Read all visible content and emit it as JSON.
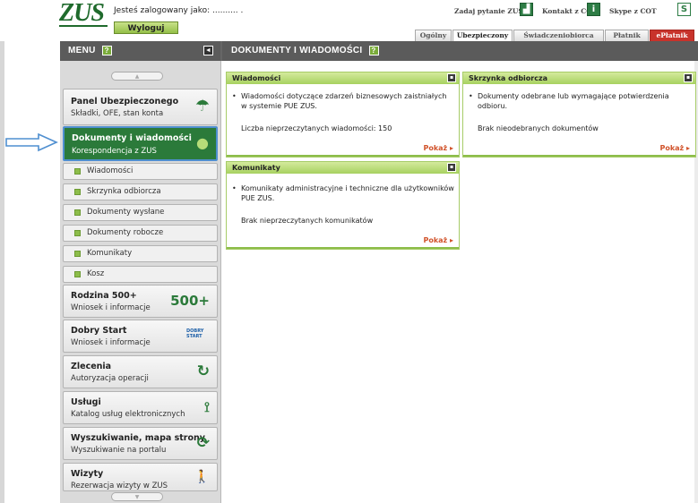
{
  "header": {
    "logo": "ZUS",
    "logged_text": "Jesteś zalogowany jako: .......... .",
    "logout_label": "Wyloguj",
    "ask_link": "Zadaj pytanie ZUS",
    "contact_link": "Kontakt z COT",
    "skype_link": "Skype z COT"
  },
  "tabs": [
    {
      "label": "Ogólny"
    },
    {
      "label": "Ubezpieczony"
    },
    {
      "label": "Świadczeniobiorca"
    },
    {
      "label": "Płatnik"
    },
    {
      "label": "ePłatnik"
    }
  ],
  "menu": {
    "title": "MENU",
    "help": "?",
    "collapse": "◄",
    "scroll_up": "▲",
    "scroll_down": "▼",
    "items": [
      {
        "title": "Panel Ubezpieczonego",
        "subtitle": "Składki, OFE, stan konta",
        "icon": "umbrella-icon",
        "glyph": "☂"
      },
      {
        "title": "Dokumenty i wiadomości",
        "subtitle": "Korespondencja z ZUS",
        "icon": "speech-bubble-icon",
        "glyph": "●"
      },
      {
        "title": "Rodzina 500+",
        "subtitle": "Wniosek i informacje",
        "icon": "rodzina-500-logo",
        "glyph": "500+"
      },
      {
        "title": "Dobry Start",
        "subtitle": "Wniosek i informacje",
        "icon": "dobry-start-logo",
        "glyph": "DOBRY START"
      },
      {
        "title": "Zlecenia",
        "subtitle": "Autoryzacja operacji",
        "icon": "refresh-icon",
        "glyph": "↻"
      },
      {
        "title": "Usługi",
        "subtitle": "Katalog usług elektronicznych",
        "icon": "usb-icon",
        "glyph": "⟟"
      },
      {
        "title": "Wyszukiwanie, mapa strony",
        "subtitle": "Wyszukiwanie na portalu",
        "icon": "sync-icon",
        "glyph": "⟳"
      },
      {
        "title": "Wizyty",
        "subtitle": "Rezerwacja wizyty w ZUS",
        "icon": "walking-person-icon",
        "glyph": "🚶"
      }
    ],
    "subitems": [
      {
        "label": "Wiadomości"
      },
      {
        "label": "Skrzynka odbiorcza"
      },
      {
        "label": "Dokumenty wysłane"
      },
      {
        "label": "Dokumenty robocze"
      },
      {
        "label": "Komunikaty"
      },
      {
        "label": "Kosz"
      }
    ]
  },
  "main": {
    "title": "DOKUMENTY I WIADOMOŚCI",
    "help": "?",
    "panels": [
      {
        "title": "Wiadomości",
        "bullet": "Wiadomości dotyczące zdarzeń biznesowych zaistniałych w systemie PUE ZUS.",
        "info": "Liczba nieprzeczytanych wiadomości: 150",
        "more": "Pokaż ▸"
      },
      {
        "title": "Skrzynka odbiorcza",
        "bullet": "Dokumenty odebrane lub wymagające potwierdzenia odbioru.",
        "info": "Brak nieodebranych dokumentów",
        "more": "Pokaż ▸"
      },
      {
        "title": "Komunikaty",
        "bullet": "Komunikaty administracyjne i techniczne dla użytkowników PUE ZUS.",
        "info": "Brak nieprzeczytanych komunikatów",
        "more": "Pokaż ▸"
      }
    ]
  },
  "colors": {
    "brand_green": "#2b7a3a",
    "light_green": "#a7d160",
    "header_gray": "#5b5b5b",
    "eplatnik_red": "#c8332b",
    "arrow_blue": "#4f8fd0",
    "link_orange": "#d1532b"
  }
}
